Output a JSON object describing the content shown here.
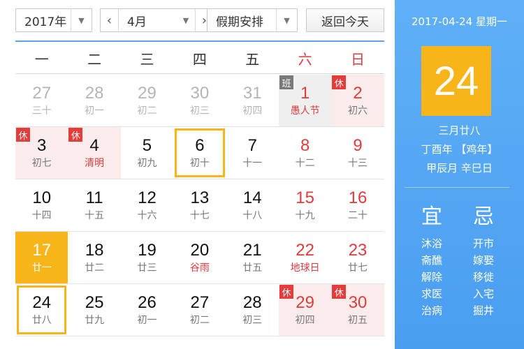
{
  "toolbar": {
    "year": "2017年",
    "month": "4月",
    "holiday": "假期安排",
    "today_button": "返回今天"
  },
  "weekdays": [
    "一",
    "二",
    "三",
    "四",
    "五",
    "六",
    "日"
  ],
  "weeks": [
    [
      {
        "n": "27",
        "l": "三十",
        "other": true
      },
      {
        "n": "28",
        "l": "初一",
        "other": true
      },
      {
        "n": "29",
        "l": "初二",
        "other": true
      },
      {
        "n": "30",
        "l": "初三",
        "other": true
      },
      {
        "n": "31",
        "l": "初四",
        "other": true
      },
      {
        "n": "1",
        "l": "愚人节",
        "we": true,
        "fest": true,
        "badge": "班",
        "work": true
      },
      {
        "n": "2",
        "l": "初六",
        "we": true,
        "badge": "休",
        "rest": true
      }
    ],
    [
      {
        "n": "3",
        "l": "初七",
        "badge": "休",
        "rest": true
      },
      {
        "n": "4",
        "l": "清明",
        "fest": true,
        "badge": "休",
        "rest": true
      },
      {
        "n": "5",
        "l": "初九"
      },
      {
        "n": "6",
        "l": "初十",
        "hl": true
      },
      {
        "n": "7",
        "l": "十一"
      },
      {
        "n": "8",
        "l": "十二",
        "we": true
      },
      {
        "n": "9",
        "l": "十三",
        "we": true
      }
    ],
    [
      {
        "n": "10",
        "l": "十四"
      },
      {
        "n": "11",
        "l": "十五"
      },
      {
        "n": "12",
        "l": "十六"
      },
      {
        "n": "13",
        "l": "十七"
      },
      {
        "n": "14",
        "l": "十八"
      },
      {
        "n": "15",
        "l": "十九",
        "we": true
      },
      {
        "n": "16",
        "l": "二十",
        "we": true
      }
    ],
    [
      {
        "n": "17",
        "l": "廿一",
        "today": true
      },
      {
        "n": "18",
        "l": "廿二"
      },
      {
        "n": "19",
        "l": "廿三"
      },
      {
        "n": "20",
        "l": "谷雨",
        "fest": true
      },
      {
        "n": "21",
        "l": "廿五"
      },
      {
        "n": "22",
        "l": "地球日",
        "we": true,
        "fest": true
      },
      {
        "n": "23",
        "l": "廿七",
        "we": true
      }
    ],
    [
      {
        "n": "24",
        "l": "廿八",
        "hl": true
      },
      {
        "n": "25",
        "l": "廿九"
      },
      {
        "n": "26",
        "l": "初一"
      },
      {
        "n": "27",
        "l": "初二"
      },
      {
        "n": "28",
        "l": "初三"
      },
      {
        "n": "29",
        "l": "初四",
        "we": true,
        "badge": "休",
        "rest": true
      },
      {
        "n": "30",
        "l": "初五",
        "we": true,
        "badge": "休",
        "rest": true
      }
    ]
  ],
  "panel": {
    "date": "2017-04-24 星期一",
    "day": "24",
    "lunar": "三月廿八",
    "ganzhi_year": "丁酉年 【鸡年】",
    "ganzhi_day": "甲辰月 辛巳日",
    "yi_label": "宜",
    "ji_label": "忌",
    "yi_items": [
      "沐浴",
      "斋醮",
      "解除",
      "求医",
      "治病"
    ],
    "ji_items": [
      "开市",
      "嫁娶",
      "移徙",
      "入宅",
      "掘井"
    ]
  },
  "colors": {
    "accent": "#4a9ef0",
    "today": "#f7b519",
    "holiday_red": "#e03c3c"
  }
}
